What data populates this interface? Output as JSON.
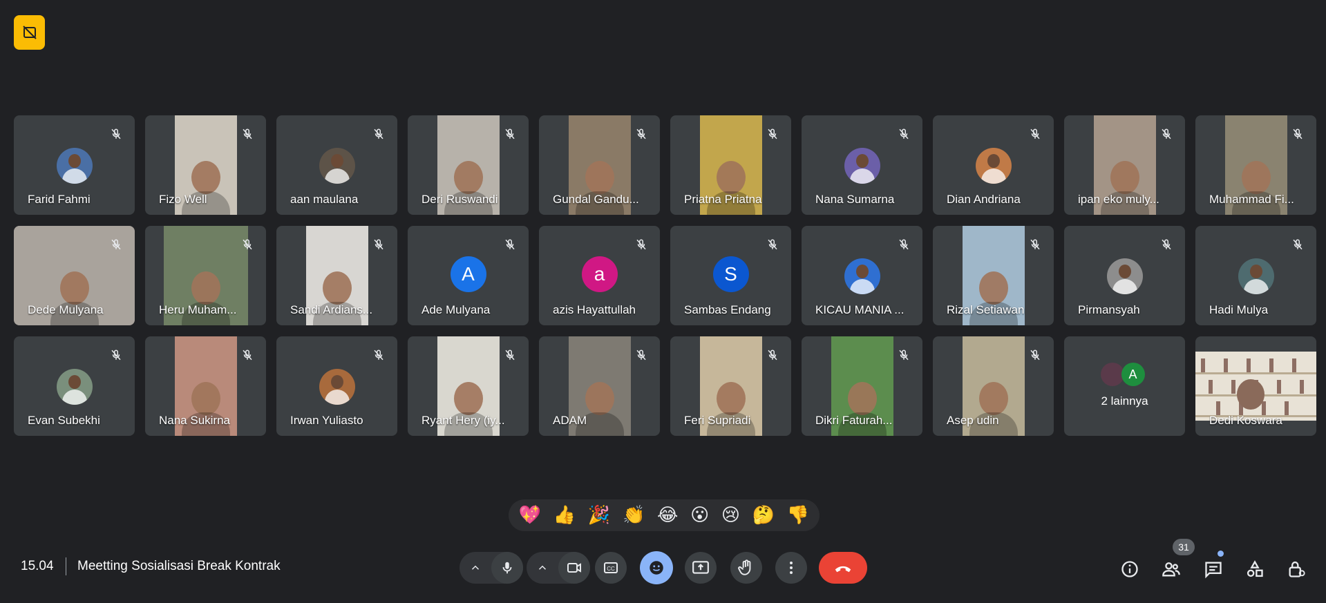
{
  "meeting": {
    "time": "15.04",
    "title": "Meetting Sosialisasi Break Kontrak",
    "participant_count": "31"
  },
  "colors": {
    "background": "#202124",
    "tile": "#3c4043",
    "accent": "#8ab4f8",
    "end_call": "#ea4335",
    "badge": "#fbbc04"
  },
  "participants": [
    {
      "name": "Farid Fahmi",
      "kind": "photo",
      "bg": "#4a6fa5"
    },
    {
      "name": "Fizo Well",
      "kind": "video",
      "bg": "#c9c3b8"
    },
    {
      "name": "aan maulana",
      "kind": "photo",
      "bg": "#5d5348"
    },
    {
      "name": "Deri Ruswandi",
      "kind": "video",
      "bg": "#b7b2aa"
    },
    {
      "name": "Gundal Gandu...",
      "kind": "video",
      "bg": "#8a7a66"
    },
    {
      "name": "Priatna Priatna",
      "kind": "video",
      "bg": "#c2a64c"
    },
    {
      "name": "Nana Sumarna",
      "kind": "photo",
      "bg": "#6b5fa8"
    },
    {
      "name": "Dian Andriana",
      "kind": "photo",
      "bg": "#c07a47"
    },
    {
      "name": "ipan eko muly...",
      "kind": "video",
      "bg": "#a39486"
    },
    {
      "name": "Muhammad Fi...",
      "kind": "video",
      "bg": "#8a8370"
    },
    {
      "name": "Dede Mulyana",
      "kind": "video-wide",
      "bg": "#a9a39c"
    },
    {
      "name": "Heru Muham...",
      "kind": "video-wide2",
      "bg": "#6f7f63"
    },
    {
      "name": "Sandi Ardians...",
      "kind": "video",
      "bg": "#d8d6d2"
    },
    {
      "name": "Ade Mulyana",
      "kind": "letter",
      "letter": "A",
      "bg": "#1a73e8"
    },
    {
      "name": "azis Hayattullah",
      "kind": "letter",
      "letter": "a",
      "bg": "#d01884"
    },
    {
      "name": "Sambas Endang",
      "kind": "letter",
      "letter": "S",
      "bg": "#0b57d0"
    },
    {
      "name": "KICAU MANIA ...",
      "kind": "photo",
      "bg": "#2f6fd1"
    },
    {
      "name": "Rizal Setiawan",
      "kind": "video",
      "bg": "#9fb7c9"
    },
    {
      "name": "Pirmansyah",
      "kind": "photo",
      "bg": "#8d8d8d"
    },
    {
      "name": "Hadi Mulya",
      "kind": "photo",
      "bg": "#4e6b6f"
    },
    {
      "name": "Evan Subekhi",
      "kind": "photo",
      "bg": "#7a8f7c"
    },
    {
      "name": "Nana Sukirna",
      "kind": "video",
      "bg": "#b98a7a"
    },
    {
      "name": "Irwan Yuliasto",
      "kind": "photo",
      "bg": "#a86a3c"
    },
    {
      "name": "Ryant Hery (iy...",
      "kind": "video",
      "bg": "#d9d7cf"
    },
    {
      "name": "ADAM",
      "kind": "video",
      "bg": "#7e7a72"
    },
    {
      "name": "Feri Supriadi",
      "kind": "video",
      "bg": "#c6b79a"
    },
    {
      "name": "Dikri Faturah...",
      "kind": "video",
      "bg": "#5c8d4e"
    },
    {
      "name": "Asep udin",
      "kind": "video",
      "bg": "#b2a98f"
    },
    {
      "name": "2 lainnya",
      "kind": "others",
      "letter": "A"
    },
    {
      "name": "Dedi Koswara",
      "kind": "bookshelf",
      "bg": "#e8e2d6"
    }
  ],
  "reactions": [
    "💖",
    "👍",
    "🎉",
    "👏",
    "😂",
    "😮",
    "😢",
    "🤔",
    "👎"
  ],
  "icons": {
    "top_badge": "no-video-icon",
    "mute": "mic-off-icon",
    "controls": [
      "chevron-up-icon",
      "mic-icon",
      "chevron-up-icon",
      "camera-icon",
      "captions-icon",
      "emoji-icon",
      "present-screen-icon",
      "raise-hand-icon",
      "more-options-icon",
      "end-call-icon"
    ],
    "right": [
      "info-icon",
      "people-icon",
      "chat-icon",
      "activities-icon",
      "host-controls-icon"
    ]
  }
}
